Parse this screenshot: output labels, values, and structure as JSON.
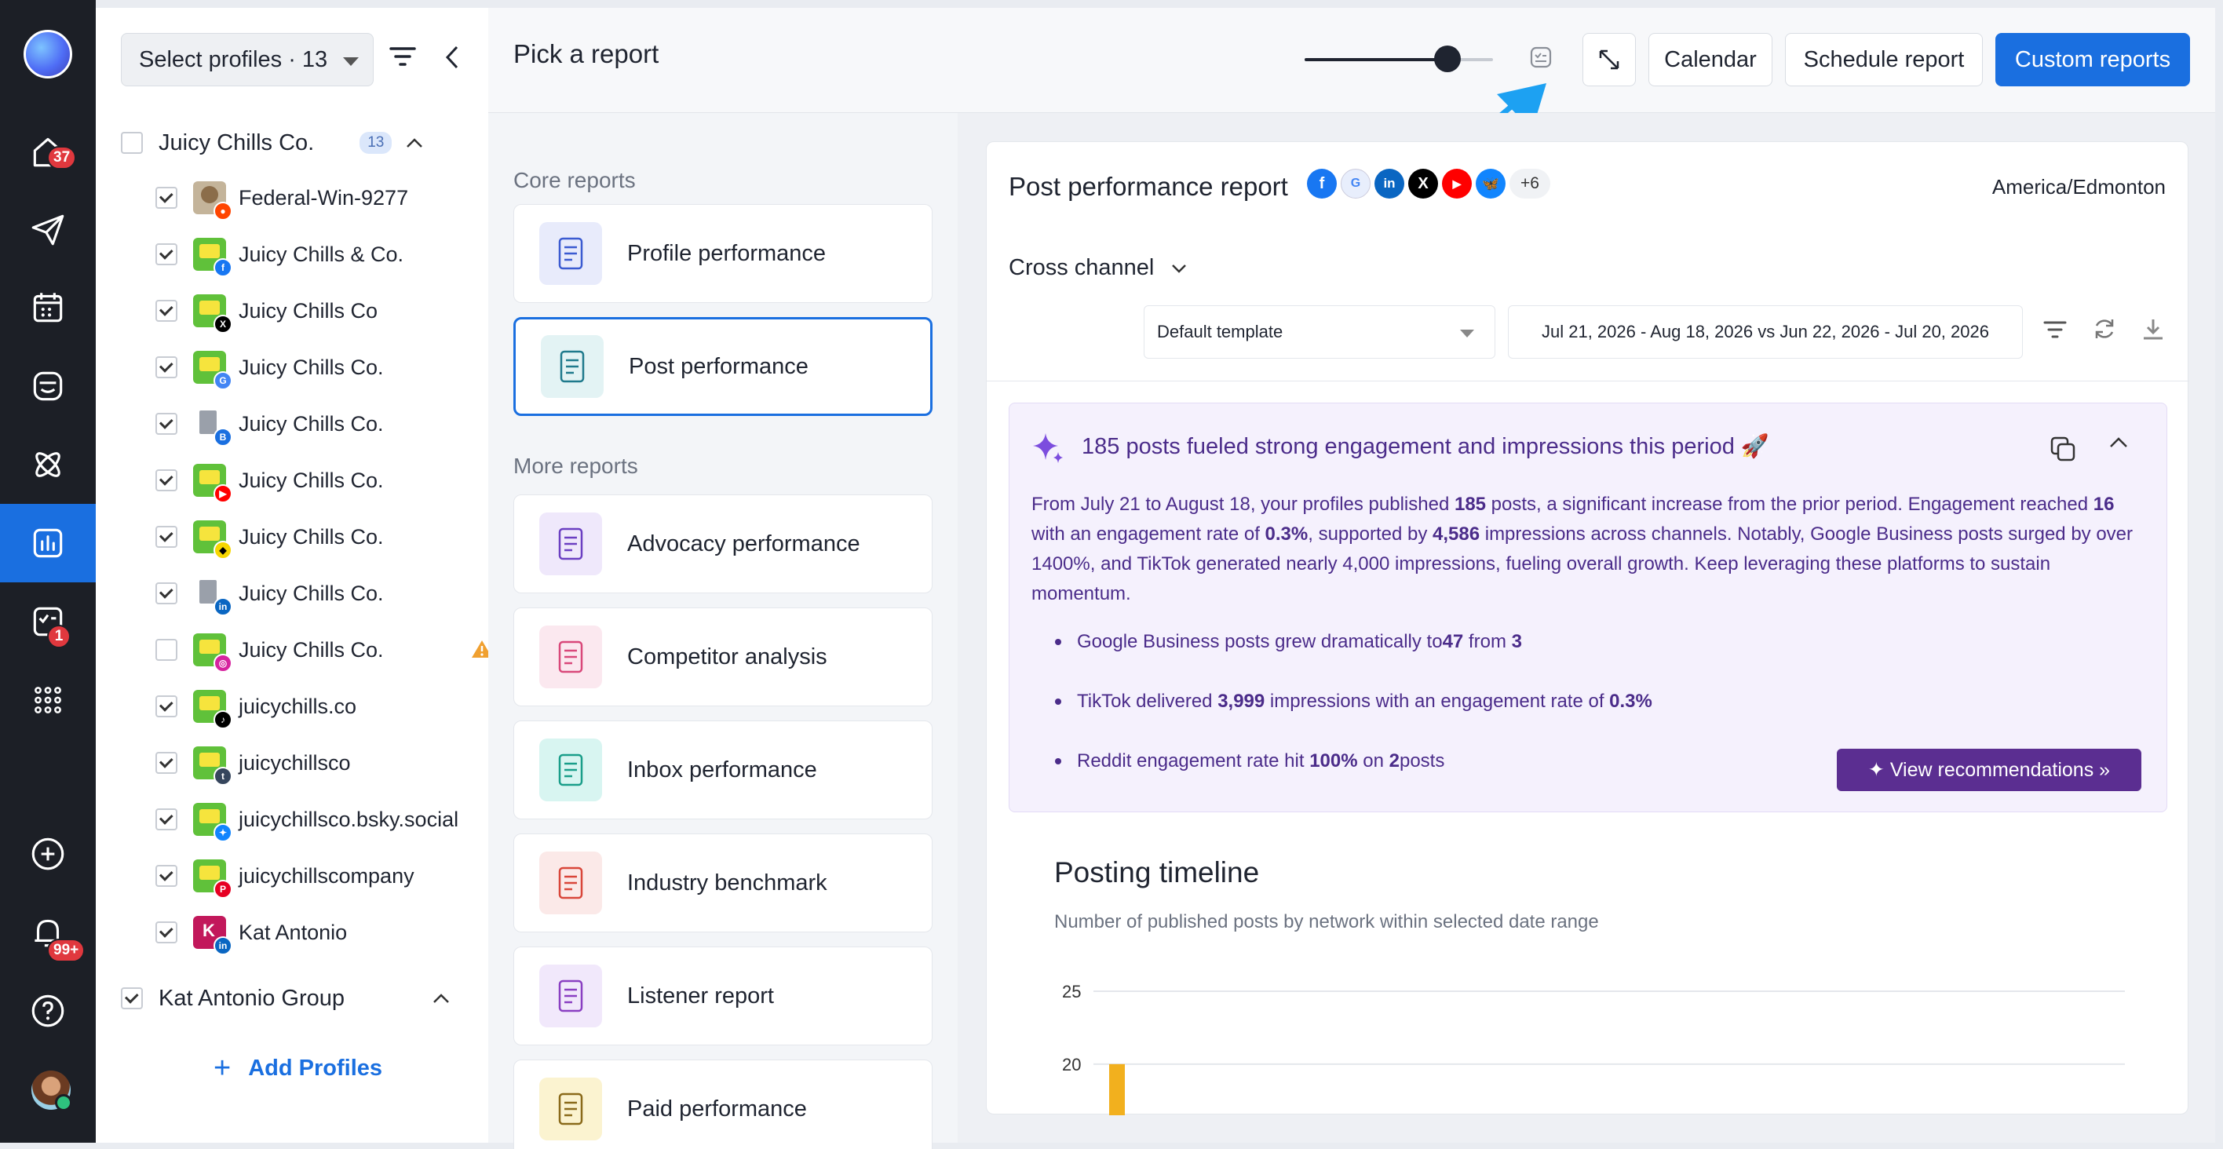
{
  "rail": {
    "home_badge": "37",
    "tasks_badge": "1",
    "notifications_badge": "99+"
  },
  "sidebar": {
    "select_profiles": "Select profiles · 13",
    "group1": {
      "name": "Juicy Chills Co.",
      "count": "13"
    },
    "profiles": [
      {
        "name": "Federal-Win-9277",
        "checked": true,
        "network": "reddit"
      },
      {
        "name": "Juicy Chills & Co.",
        "checked": true,
        "network": "facebook"
      },
      {
        "name": "Juicy Chills Co",
        "checked": true,
        "network": "x"
      },
      {
        "name": "Juicy Chills Co.",
        "checked": true,
        "network": "google-business"
      },
      {
        "name": "Juicy Chills Co.",
        "checked": true,
        "network": "google-business-building"
      },
      {
        "name": "Juicy Chills Co.",
        "checked": true,
        "network": "youtube"
      },
      {
        "name": "Juicy Chills Co.",
        "checked": true,
        "network": "snapchat"
      },
      {
        "name": "Juicy Chills Co.",
        "checked": true,
        "network": "linkedin-building"
      },
      {
        "name": "Juicy Chills Co.",
        "checked": false,
        "network": "instagram"
      },
      {
        "name": "juicychills.co",
        "checked": true,
        "network": "tiktok"
      },
      {
        "name": "juicychillsco",
        "checked": true,
        "network": "tumblr"
      },
      {
        "name": "juicychillsco.bsky.social",
        "checked": true,
        "network": "bluesky"
      },
      {
        "name": "juicychillscompany",
        "checked": true,
        "network": "pinterest"
      },
      {
        "name": "Kat Antonio",
        "checked": true,
        "network": "linkedin"
      }
    ],
    "group2": {
      "name": "Kat Antonio Group"
    },
    "add_profiles": "Add Profiles"
  },
  "header": {
    "title": "Pick a report",
    "zoom_level": 0.76,
    "calendar": "Calendar",
    "schedule": "Schedule report",
    "custom": "Custom reports"
  },
  "reports": {
    "core_label": "Core reports",
    "more_label": "More reports",
    "core": [
      {
        "label": "Profile performance",
        "icon": "profile-performance-icon"
      },
      {
        "label": "Post performance",
        "icon": "post-performance-icon"
      }
    ],
    "more": [
      {
        "label": "Advocacy performance",
        "icon": "advocacy-icon"
      },
      {
        "label": "Competitor analysis",
        "icon": "competitor-icon"
      },
      {
        "label": "Inbox performance",
        "icon": "inbox-icon"
      },
      {
        "label": "Industry benchmark",
        "icon": "benchmark-icon"
      },
      {
        "label": "Listener report",
        "icon": "listener-icon"
      },
      {
        "label": "Paid performance",
        "icon": "paid-icon"
      }
    ]
  },
  "panel": {
    "title": "Post performance report",
    "more_networks": "+6",
    "timezone": "America/Edmonton",
    "cross_channel": "Cross channel",
    "template": "Default template",
    "date_range": "Jul 21, 2026 - Aug 18, 2026 vs Jun 22, 2026 - Jul 20, 2026",
    "ai": {
      "headline": "185 posts fueled strong engagement and impressions this period 🚀",
      "p_1": "From July 21 to August 18, your profiles published ",
      "p_185": "185",
      "p_2": " posts, a significant increase from the prior period. Engagement reached ",
      "p_16": "16",
      "p_3": " with an engagement rate of ",
      "p_03": "0.3%",
      "p_4": ", supported by ",
      "p_4586": "4,586",
      "p_5": " impressions across channels. Notably, Google Business posts surged by over 1400%, and TikTok generated nearly 4,000 impressions, fueling overall growth. Keep leveraging these platforms to sustain momentum.",
      "b1_a": "Google Business posts grew dramatically to ",
      "b1_b": "47",
      "b1_c": " from ",
      "b1_d": "3",
      "b2_a": "TikTok delivered ",
      "b2_b": "3,999",
      "b2_c": " impressions with an engagement rate of ",
      "b2_d": "0.3%",
      "b3_a": "Reddit engagement rate hit ",
      "b3_b": "100%",
      "b3_c": " on ",
      "b3_d": "2",
      "b3_e": " posts",
      "view": "View recommendations »"
    },
    "timeline": {
      "title": "Posting timeline",
      "subtitle": "Number of published posts by network within selected date range"
    }
  },
  "chart_data": {
    "type": "bar",
    "title": "Posting timeline",
    "subtitle": "Number of published posts by network within selected date range",
    "y_ticks": [
      "25",
      "20"
    ],
    "ylim_visible": [
      18,
      25
    ],
    "series": [
      {
        "color": "#f2b01e",
        "values": [
          20
        ]
      }
    ]
  },
  "colors": {
    "accent": "#1a6fe0",
    "ai_purple": "#5b2e91",
    "rail": "#1c1f26"
  }
}
